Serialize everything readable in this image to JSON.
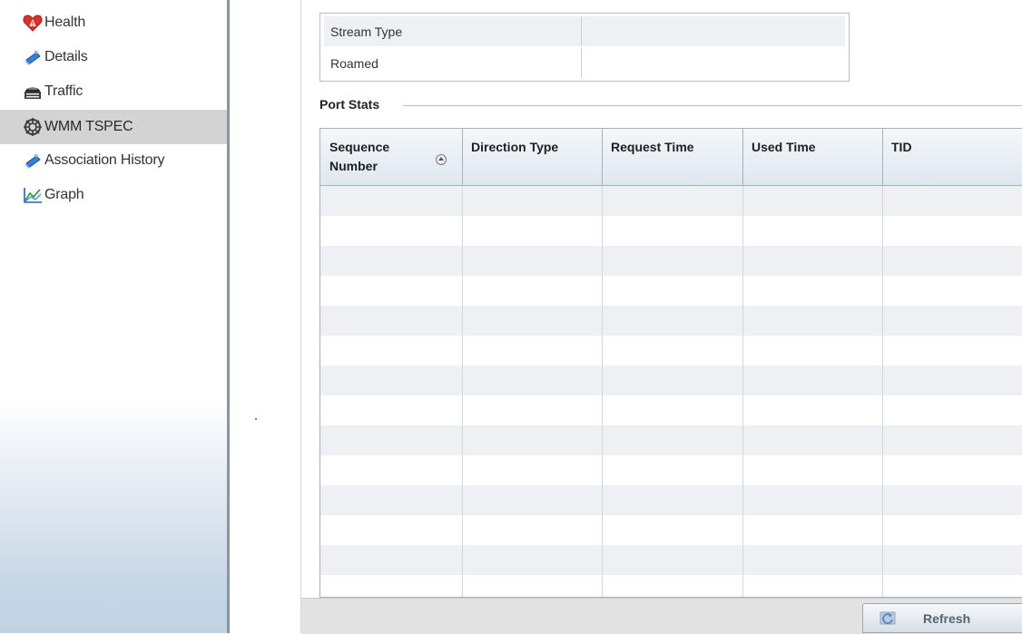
{
  "sidebar": {
    "items": [
      {
        "label": "Health",
        "icon": "health-icon"
      },
      {
        "label": "Details",
        "icon": "details-icon"
      },
      {
        "label": "Traffic",
        "icon": "traffic-icon"
      },
      {
        "label": "WMM TSPEC",
        "icon": "wmm-tspec-icon",
        "selected": true
      },
      {
        "label": "Association History",
        "icon": "association-history-icon"
      },
      {
        "label": "Graph",
        "icon": "graph-icon"
      }
    ]
  },
  "properties": {
    "rows": [
      {
        "label": "Stream Type",
        "value": ""
      },
      {
        "label": "Roamed",
        "value": ""
      }
    ]
  },
  "port_stats": {
    "title": "Port Stats",
    "columns": [
      {
        "label": "Sequence Number",
        "sorted": "ascending"
      },
      {
        "label": "Direction Type"
      },
      {
        "label": "Request Time"
      },
      {
        "label": "Used Time"
      },
      {
        "label": "TID"
      }
    ],
    "rows": []
  },
  "footer": {
    "refresh_label": "Refresh",
    "refresh_icon": "refresh-icon"
  },
  "colors": {
    "selected_row": "#d3d3d3",
    "header_gradient_top": "#f4f7fa",
    "header_gradient_bottom": "#dfe7ef",
    "alt_row": "#eef0f4",
    "button_text": "#566472"
  }
}
